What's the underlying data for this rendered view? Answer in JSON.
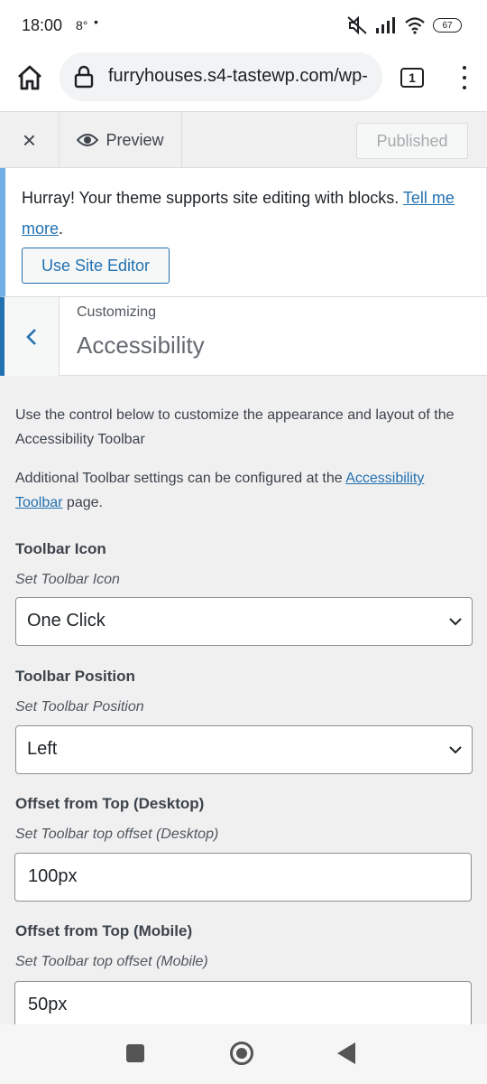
{
  "status_bar": {
    "time": "18:00",
    "temperature": "8°",
    "dot": "•",
    "battery": "67"
  },
  "browser": {
    "url": "furryhouses.s4-tastewp.com/wp-",
    "tab_count": "1"
  },
  "customizer_header": {
    "close_label": "×",
    "preview_label": "Preview",
    "published_label": "Published"
  },
  "notice": {
    "text": "Hurray! Your theme supports site editing with blocks. ",
    "link": "Tell me more",
    "after_link": ".",
    "button_label": "Use Site Editor"
  },
  "section": {
    "customizing": "Customizing",
    "title": "Accessibility"
  },
  "content": {
    "description": "Use the control below to customize the appearance and layout of the Accessibility Toolbar",
    "additional_text": "Additional Toolbar settings can be configured at the ",
    "additional_link": "Accessibility Toolbar",
    "additional_after": " page.",
    "fields": [
      {
        "label": "Toolbar Icon",
        "sublabel": "Set Toolbar Icon",
        "value": "One Click",
        "type": "select"
      },
      {
        "label": "Toolbar Position",
        "sublabel": "Set Toolbar Position",
        "value": "Left",
        "type": "select"
      },
      {
        "label": "Offset from Top (Desktop)",
        "sublabel": "Set Toolbar top offset (Desktop)",
        "value": "100px",
        "type": "input"
      },
      {
        "label": "Offset from Top (Mobile)",
        "sublabel": "Set Toolbar top offset (Mobile)",
        "value": "50px",
        "type": "input"
      }
    ]
  },
  "colors": {
    "accent": "#2271b1",
    "notice_border": "#72aee6",
    "background": "#f0f0f1"
  }
}
